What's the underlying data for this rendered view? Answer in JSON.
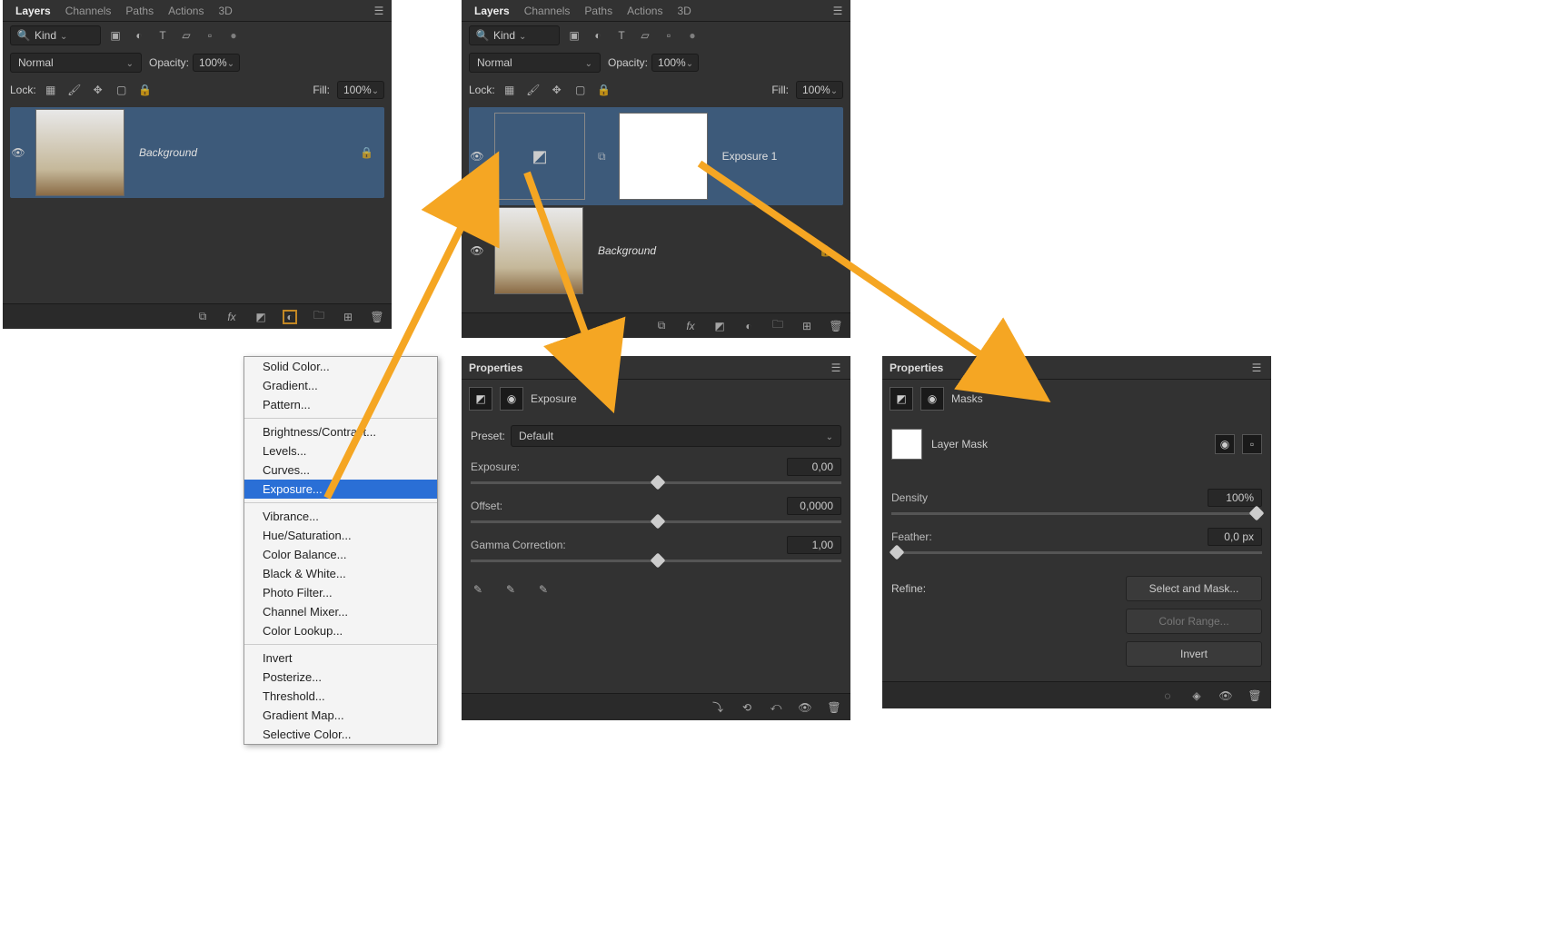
{
  "tabs": {
    "layers": "Layers",
    "channels": "Channels",
    "paths": "Paths",
    "actions": "Actions",
    "threeD": "3D"
  },
  "kind": "Kind",
  "blend": {
    "normal": "Normal",
    "opacity_label": "Opacity:",
    "opacity_val": "100%"
  },
  "lock": {
    "label": "Lock:",
    "fill_label": "Fill:",
    "fill_val": "100%"
  },
  "layers_left": {
    "background": "Background"
  },
  "layers_mid": {
    "exposure1": "Exposure 1",
    "background": "Background"
  },
  "menu": {
    "solid": "Solid Color...",
    "gradient": "Gradient...",
    "pattern": "Pattern...",
    "brightness": "Brightness/Contrast...",
    "levels": "Levels...",
    "curves": "Curves...",
    "exposure": "Exposure...",
    "vibrance": "Vibrance...",
    "huesat": "Hue/Saturation...",
    "colorbalance": "Color Balance...",
    "bw": "Black & White...",
    "photofilter": "Photo Filter...",
    "channelmixer": "Channel Mixer...",
    "colorlookup": "Color Lookup...",
    "invert": "Invert",
    "posterize": "Posterize...",
    "threshold": "Threshold...",
    "gradientmap": "Gradient Map...",
    "selectivecolor": "Selective Color..."
  },
  "props_exposure": {
    "title": "Properties",
    "type": "Exposure",
    "preset_label": "Preset:",
    "preset_val": "Default",
    "exposure_label": "Exposure:",
    "exposure_val": "0,00",
    "offset_label": "Offset:",
    "offset_val": "0,0000",
    "gamma_label": "Gamma Correction:",
    "gamma_val": "1,00"
  },
  "props_masks": {
    "title": "Properties",
    "type": "Masks",
    "layermask": "Layer Mask",
    "density_label": "Density",
    "density_val": "100%",
    "feather_label": "Feather:",
    "feather_val": "0,0 px",
    "refine_label": "Refine:",
    "select_mask": "Select and Mask...",
    "color_range": "Color Range...",
    "invert_btn": "Invert"
  }
}
